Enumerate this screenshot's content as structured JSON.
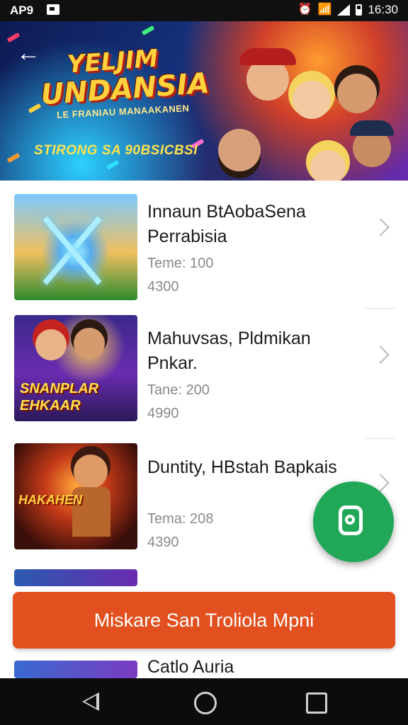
{
  "status_bar": {
    "carrier": "AP9",
    "time": "16:30"
  },
  "banner": {
    "title_line1": "YELJIM",
    "title_line2": "UNDANSIA",
    "subtitle": "LE FRANIAU MANAAKANEN",
    "tagline": "STIRONG SA 90BSICBSI"
  },
  "items": [
    {
      "name": "Innaun BtAobaSena Perrabisia",
      "meta": "Teme: 100",
      "count": "4300",
      "thumb_text": ""
    },
    {
      "name": "Mahuvsas, Pldmikan Pnkar.",
      "meta": "Tane: 200",
      "count": "4990",
      "thumb_text": "SNANPLAR EHKAAR"
    },
    {
      "name": "Duntity, HBstah Bapkais",
      "meta": "Tema: 208",
      "count": "4390",
      "thumb_text": "HAKAHEN"
    },
    {
      "name": "Catlo Auria",
      "meta": "",
      "count": "",
      "thumb_text": ""
    }
  ],
  "cta": {
    "label": "Miskare San Troliola Mpni"
  },
  "fab": {
    "icon": "chat-phone-icon",
    "color": "#20a858"
  },
  "colors": {
    "cta": "#e2501f",
    "fab": "#20a858"
  }
}
